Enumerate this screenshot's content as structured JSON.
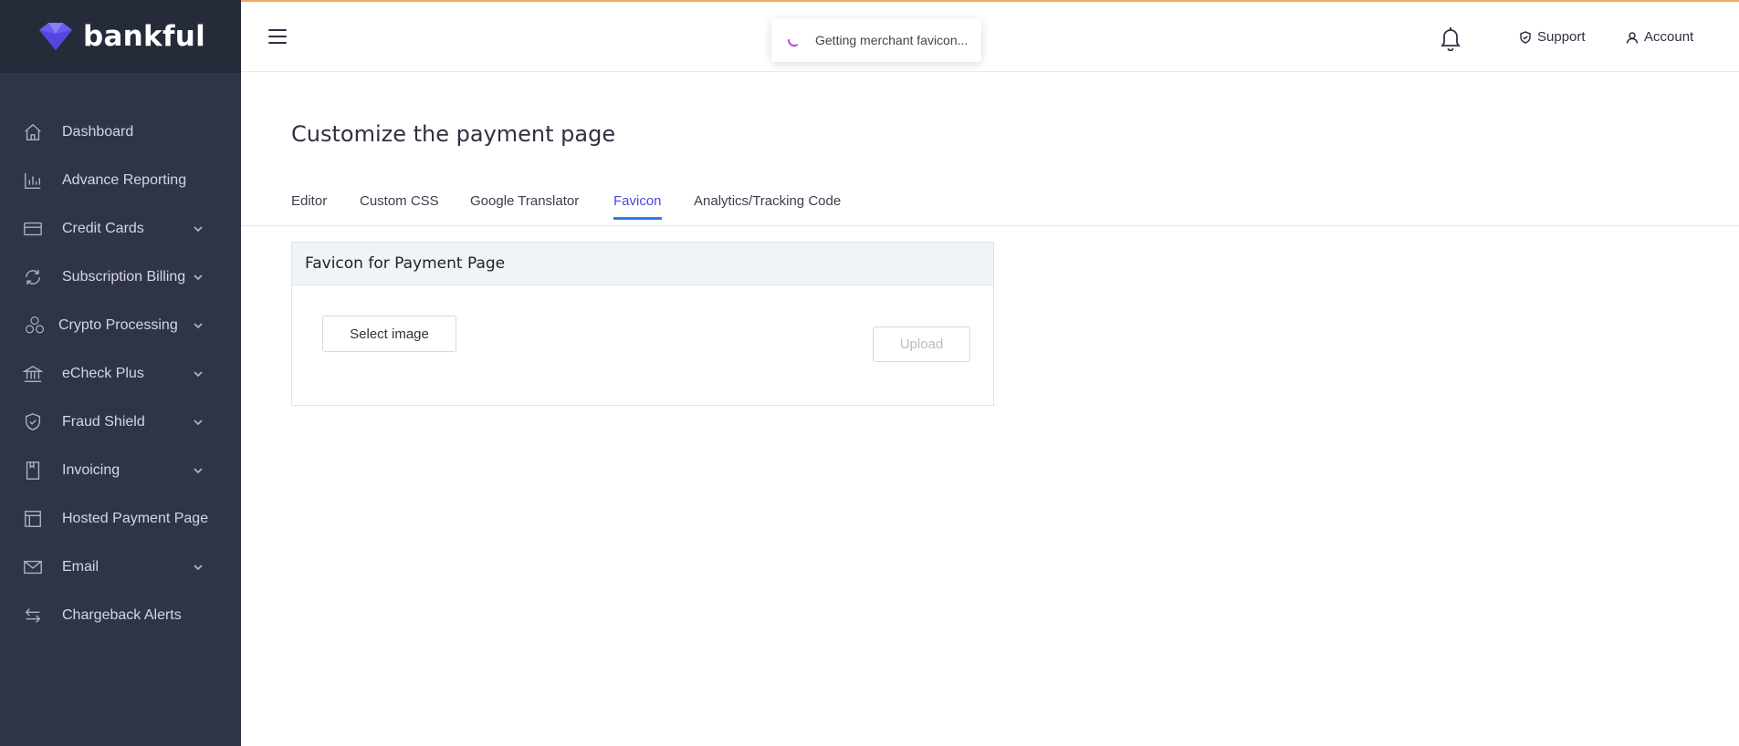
{
  "brand": {
    "name": "bankful"
  },
  "sidebar": {
    "items": [
      {
        "label": "Dashboard",
        "icon": "home-icon",
        "has_submenu": false
      },
      {
        "label": "Advance Reporting",
        "icon": "bar-chart-icon",
        "has_submenu": false
      },
      {
        "label": "Credit Cards",
        "icon": "credit-card-icon",
        "has_submenu": true
      },
      {
        "label": "Subscription Billing",
        "icon": "refresh-icon",
        "has_submenu": true
      },
      {
        "label": "Crypto Processing",
        "icon": "coins-icon",
        "has_submenu": true
      },
      {
        "label": "eCheck Plus",
        "icon": "bank-icon",
        "has_submenu": true
      },
      {
        "label": "Fraud Shield",
        "icon": "shield-check-icon",
        "has_submenu": true
      },
      {
        "label": "Invoicing",
        "icon": "document-icon",
        "has_submenu": true
      },
      {
        "label": "Hosted Payment Page",
        "icon": "layout-icon",
        "has_submenu": false
      },
      {
        "label": "Email",
        "icon": "mail-icon",
        "has_submenu": true
      },
      {
        "label": "Chargeback Alerts",
        "icon": "transfer-arrows-icon",
        "has_submenu": false
      }
    ]
  },
  "header": {
    "toast": "Getting merchant favicon...",
    "support_label": "Support",
    "account_label": "Account"
  },
  "main": {
    "title": "Customize the payment page",
    "tabs": [
      {
        "label": "Editor",
        "active": false
      },
      {
        "label": "Custom CSS",
        "active": false
      },
      {
        "label": "Google Translator",
        "active": false
      },
      {
        "label": "Favicon",
        "active": true
      },
      {
        "label": "Analytics/Tracking Code",
        "active": false
      }
    ],
    "card": {
      "title": "Favicon for Payment Page",
      "select_label": "Select image",
      "upload_label": "Upload"
    }
  },
  "colors": {
    "sidebar_bg": "#2f3547",
    "brand_bg": "#262b39",
    "brand_accent": "#6a5cf0",
    "active_tab": "#4b4ad8",
    "tab_underline": "#2d7ce8",
    "top_accent": "#f2a65a"
  }
}
